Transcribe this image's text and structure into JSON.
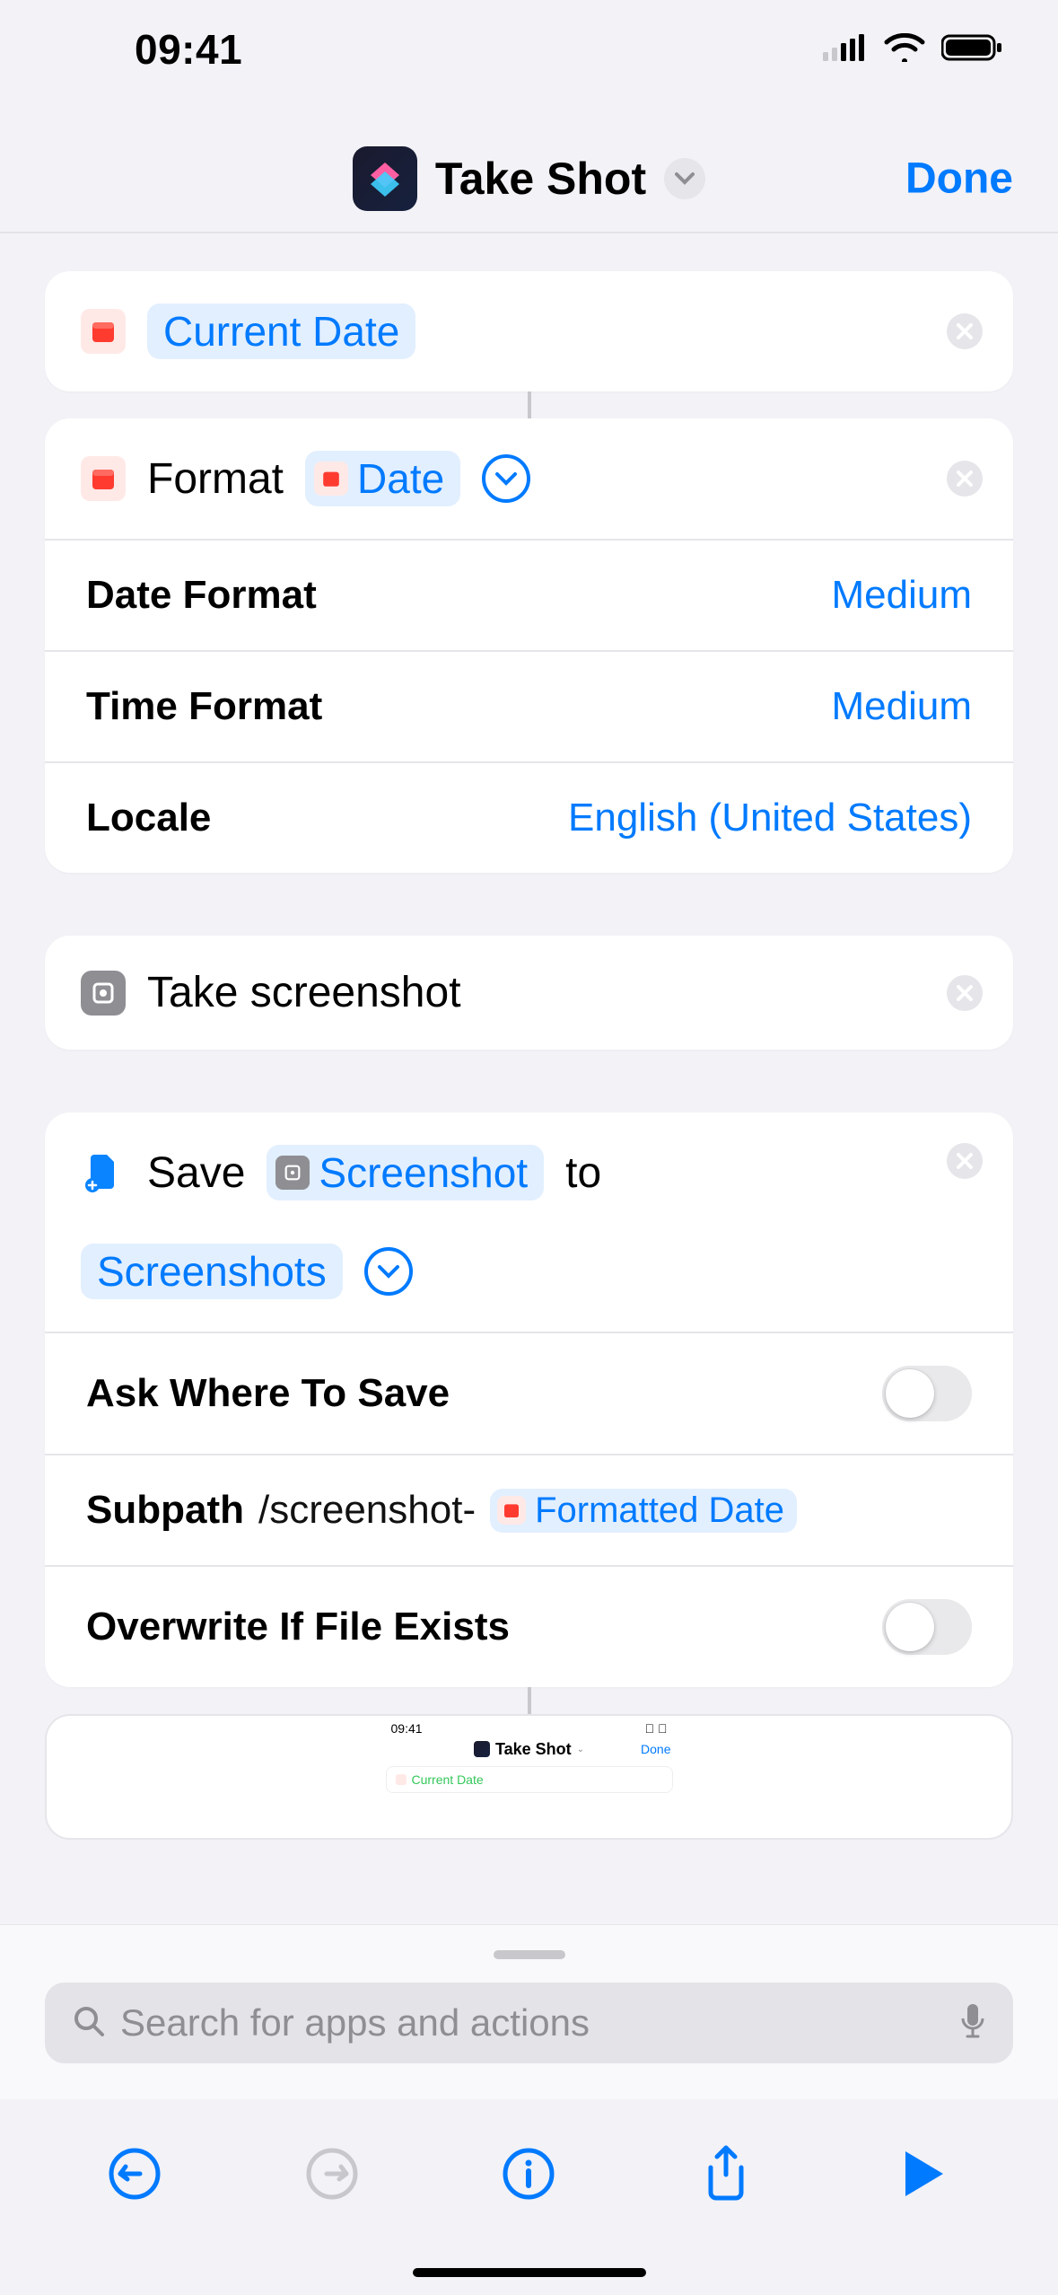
{
  "status": {
    "time": "09:41"
  },
  "nav": {
    "title": "Take Shot",
    "done": "Done"
  },
  "actions": {
    "current_date": {
      "token": "Current Date"
    },
    "format": {
      "label": "Format",
      "token": "Date",
      "rows": {
        "date_format": {
          "label": "Date Format",
          "value": "Medium"
        },
        "time_format": {
          "label": "Time Format",
          "value": "Medium"
        },
        "locale": {
          "label": "Locale",
          "value": "English (United States)"
        }
      }
    },
    "screenshot": {
      "label": "Take screenshot"
    },
    "save": {
      "verb": "Save",
      "input_token": "Screenshot",
      "to_word": "to",
      "dest_token": "Screenshots",
      "rows": {
        "ask_where": {
          "label": "Ask Where To Save",
          "value": false
        },
        "subpath": {
          "label": "Subpath",
          "prefix": "/screenshot-",
          "token": "Formatted Date"
        },
        "overwrite": {
          "label": "Overwrite If File Exists",
          "value": false
        }
      }
    }
  },
  "preview": {
    "time": "09:41",
    "title": "Take Shot",
    "done": "Done",
    "row_token": "Current Date"
  },
  "search": {
    "placeholder": "Search for apps and actions"
  }
}
